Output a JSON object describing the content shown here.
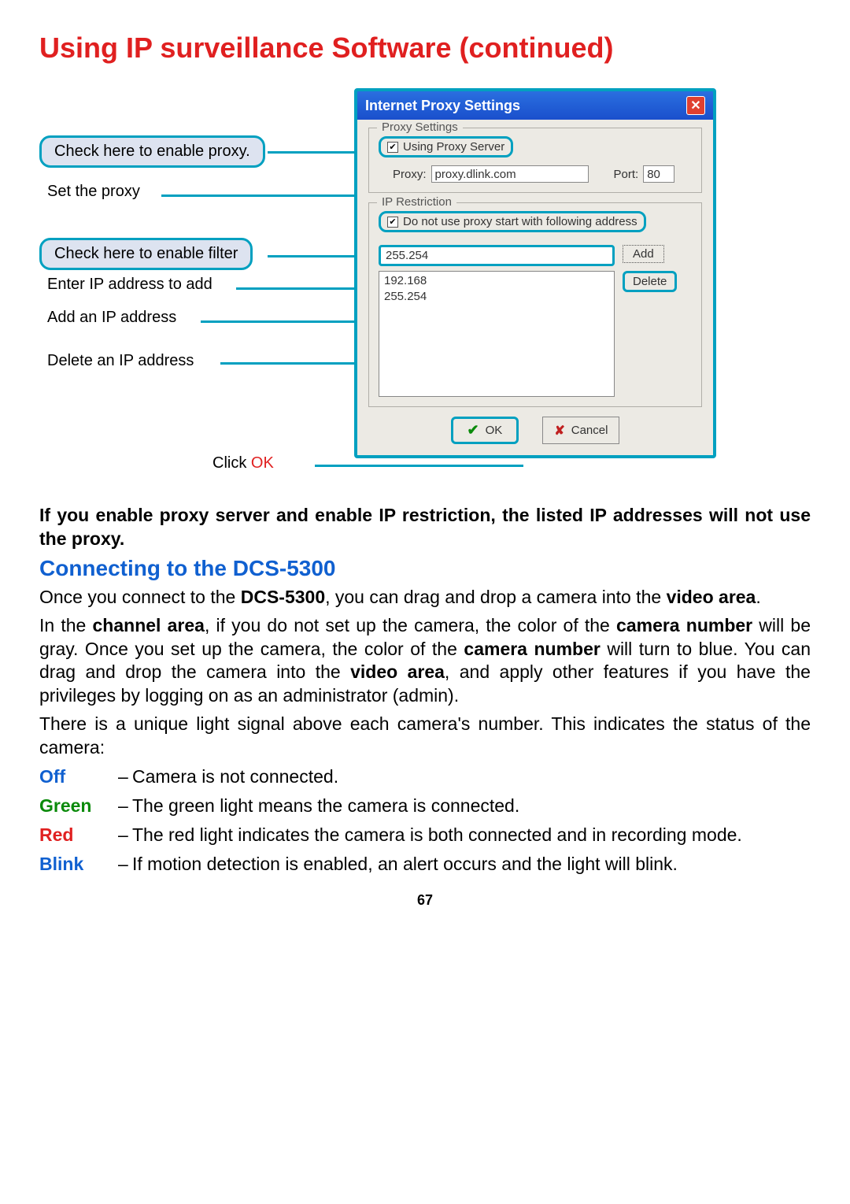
{
  "title": "Using IP surveillance Software (continued)",
  "callouts": {
    "enable_proxy": "Check here to enable proxy.",
    "set_proxy": "Set the proxy",
    "enable_filter": "Check here to enable filter",
    "enter_ip": "Enter IP address to add",
    "add_ip": "Add an  IP address",
    "delete_ip": "Delete an IP address",
    "click_ok_prefix": "Click ",
    "click_ok_ok": "OK"
  },
  "dialog": {
    "title": "Internet Proxy Settings",
    "proxy_settings_legend": "Proxy Settings",
    "using_proxy_label": "Using Proxy Server",
    "proxy_label": "Proxy:",
    "proxy_value": "proxy.dlink.com",
    "port_label": "Port:",
    "port_value": "80",
    "ip_restriction_legend": "IP Restriction",
    "no_proxy_label": "Do not use proxy start with following address",
    "ip_input_value": "255.254",
    "add_label": "Add",
    "delete_label": "Delete",
    "list_items": [
      "192.168",
      "255.254"
    ],
    "ok_label": "OK",
    "cancel_label": "Cancel"
  },
  "paragraphs": {
    "p1": "If you enable proxy server and enable IP restriction, the listed IP addresses will not use the proxy.",
    "section": "Connecting to the DCS-5300",
    "p2a": "Once you connect to the ",
    "p2b": "DCS-5300",
    "p2c": ", you can drag and drop a camera into the ",
    "p2d": "video area",
    "p2e": ".",
    "p3": "In the channel area, if you do not set up the camera, the color of the camera number will be gray. Once you set up the camera, the color of the camera number will turn to blue. You can drag and drop the camera into the video area, and apply other features if you have the privileges by logging on as an administrator (admin).",
    "p4": "There is a unique light signal above each camera's number. This indicates the status of the camera:"
  },
  "status": {
    "off_key": "Off",
    "off_text": "Camera is not connected.",
    "green_key": "Green",
    "green_text": "The green light means the camera is connected.",
    "red_key": "Red",
    "red_text": "The red light indicates the camera is both connected and in recording mode.",
    "blink_key": "Blink",
    "blink_text": "If motion detection is enabled, an alert occurs and the light will blink."
  },
  "page_number": "67"
}
